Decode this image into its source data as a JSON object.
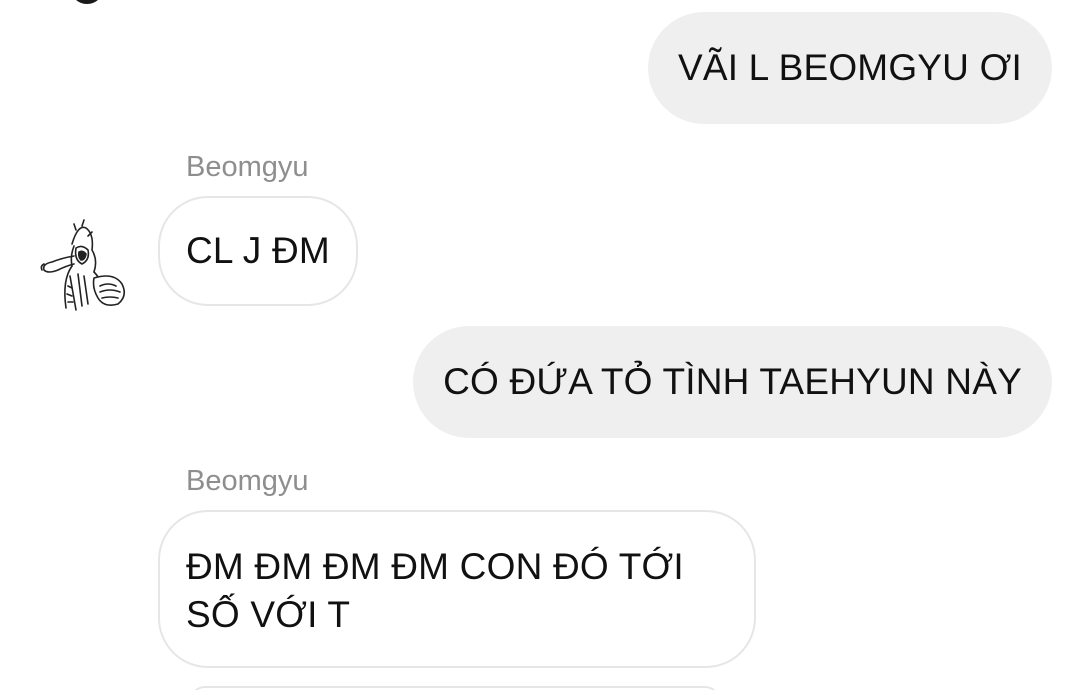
{
  "conversation": {
    "messages": [
      {
        "direction": "outgoing",
        "text": "VÃI L BEOMGYU ƠI"
      },
      {
        "direction": "incoming",
        "sender": "Beomgyu",
        "text": "CL J ĐM",
        "avatar_icon": "sketch-avatar-icon"
      },
      {
        "direction": "outgoing",
        "text": "CÓ ĐỨA TỎ TÌNH TAEHYUN NÀY"
      },
      {
        "direction": "incoming",
        "sender": "Beomgyu",
        "text": "ĐM ĐM ĐM ĐM CON ĐÓ TỚI SỐ VỚI T"
      }
    ]
  },
  "colors": {
    "outgoing_bubble": "#efefef",
    "incoming_border": "#e6e6e6",
    "sender_name": "#8e8e8e",
    "message_text": "#111111"
  }
}
